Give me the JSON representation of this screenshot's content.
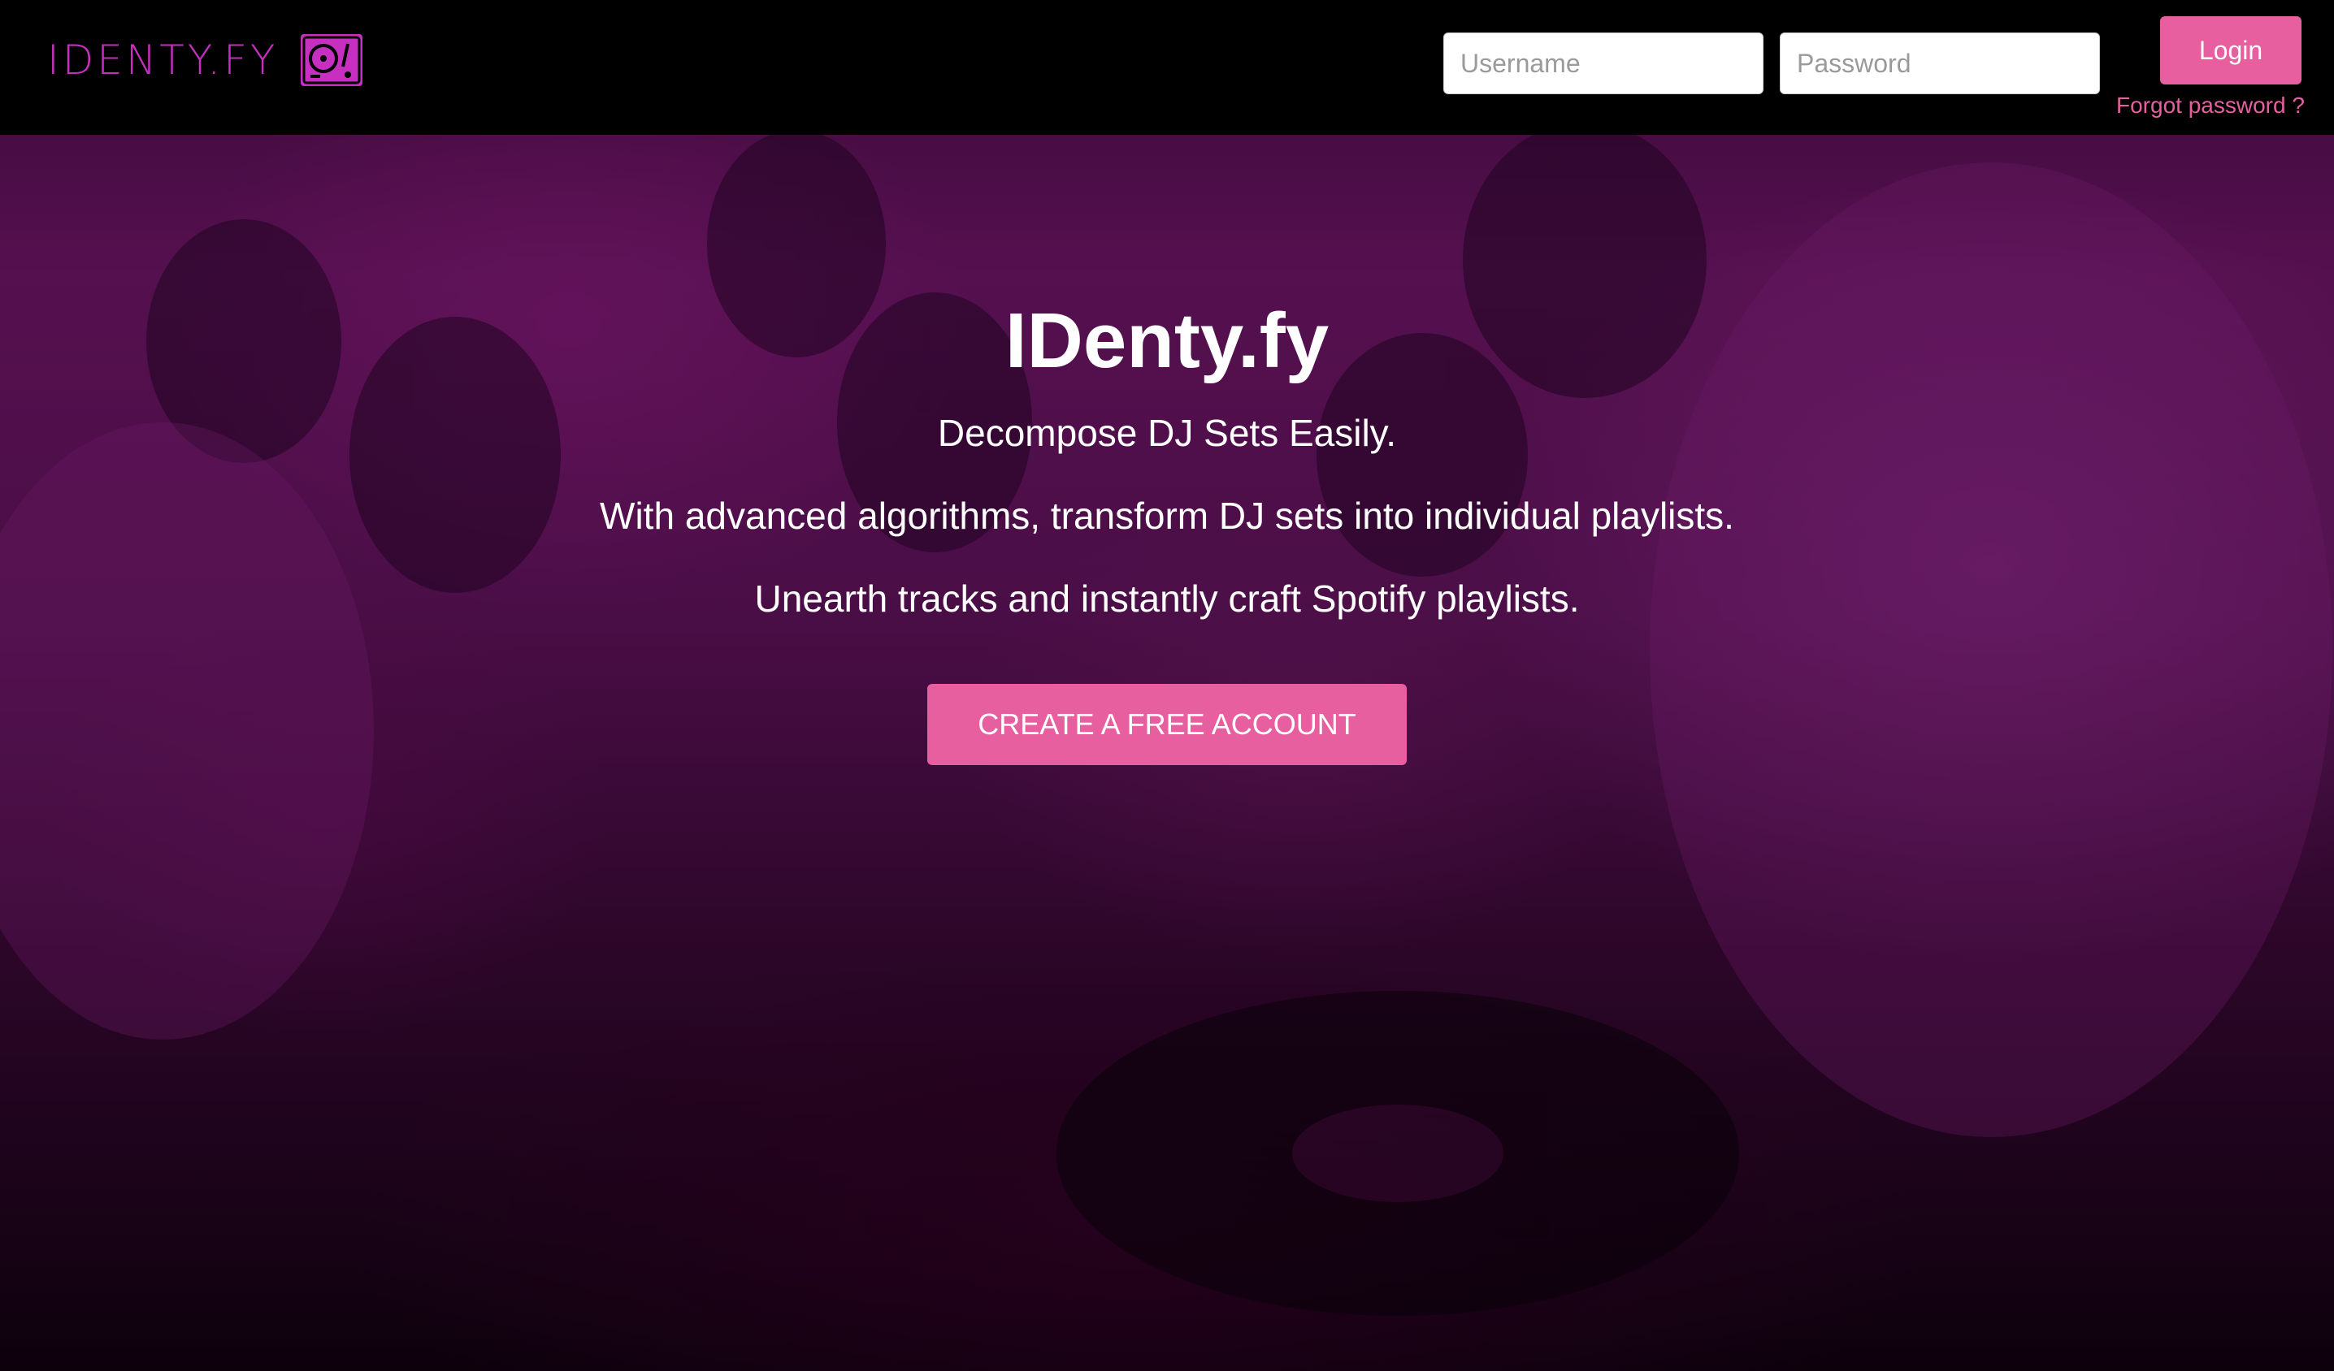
{
  "brand": {
    "logo_text": "IDENTY.FY",
    "logo_icon": "turntable-icon",
    "accent_color": "#c62fbf"
  },
  "login": {
    "username_placeholder": "Username",
    "password_placeholder": "Password",
    "login_label": "Login",
    "forgot_label": "Forgot password ?",
    "button_color": "#e85fa0"
  },
  "hero": {
    "title": "IDenty.fy",
    "tagline": "Decompose DJ Sets Easily.",
    "line2": "With advanced algorithms, transform DJ sets into individual playlists.",
    "line3": "Unearth tracks and instantly craft Spotify playlists.",
    "cta_label": "CREATE A FREE ACCOUNT"
  }
}
